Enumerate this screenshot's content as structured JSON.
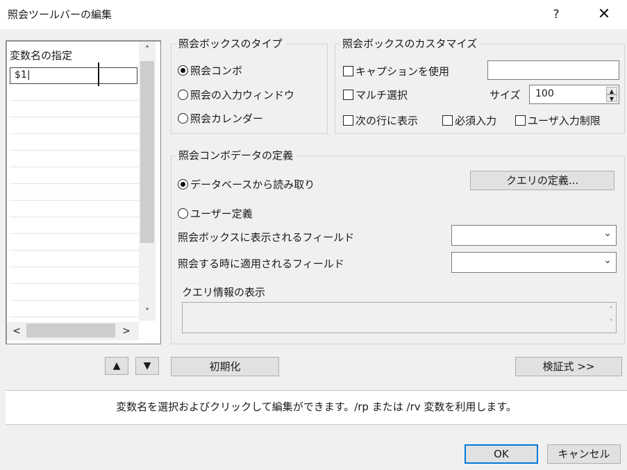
{
  "window": {
    "title": "照会ツールバーの編集",
    "help_label": "?",
    "close_label": "✕"
  },
  "var_list": {
    "header": "変数名の指定",
    "editing_value": "$1|",
    "scroll_up": "˄",
    "scroll_down": "˅",
    "scroll_left": "<",
    "scroll_right": ">"
  },
  "box_type": {
    "legend": "照会ボックスのタイプ",
    "options": [
      {
        "label": "照会コンボ",
        "selected": true
      },
      {
        "label": "照会の入力ウィンドウ",
        "selected": false
      },
      {
        "label": "照会カレンダー",
        "selected": false
      }
    ]
  },
  "customize": {
    "legend": "照会ボックスのカスタマイズ",
    "use_caption": "キャプションを使用",
    "caption_value": "",
    "multi_select": "マルチ選択",
    "size_label": "サイズ",
    "size_value": "100",
    "show_next_line": "次の行に表示",
    "required": "必須入力",
    "user_input_limit": "ユーザ入力制限"
  },
  "combo_data": {
    "legend": "照会コンボデータの定義",
    "from_db": "データベースから読み取り",
    "user_defined": "ユーザー定義",
    "define_query_btn": "クエリの定義...",
    "display_field_label": "照会ボックスに表示されるフィールド",
    "display_field_value": "",
    "apply_field_label": "照会する時に適用されるフィールド",
    "apply_field_value": "",
    "query_info_label": "クエリ情報の表示",
    "query_info_value": ""
  },
  "bottom": {
    "move_up": "▲",
    "move_down": "▼",
    "reset_btn": "初期化",
    "verify_btn": "検証式 >>",
    "status_text": "変数名を選択およびクリックして編集ができます。/rp または /rv 変数を利用します。",
    "ok_btn": "OK",
    "cancel_btn": "キャンセル"
  }
}
